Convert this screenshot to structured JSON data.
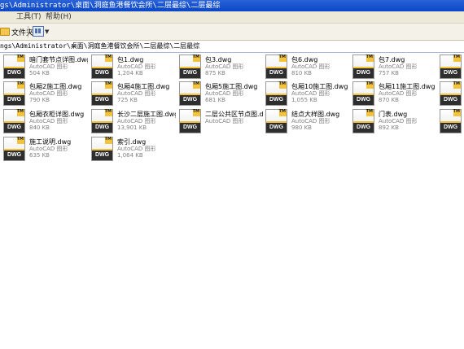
{
  "window": {
    "title": "gs\\Administrator\\桌面\\洞庭鱼港餐饮会所\\二层最综\\二层最综"
  },
  "menubar": {
    "items": [
      "工具(T)",
      "帮助(H)"
    ]
  },
  "toolbar": {
    "folders_label": "文件夹"
  },
  "address": {
    "path": "ngs\\Administrator\\桌面\\洞庭鱼港餐饮会所\\二层最综\\二层最综"
  },
  "file_type": "AutoCAD 图形",
  "icon_label": "DWG",
  "icon_tm": "TM",
  "files": [
    {
      "name": "暗门套节点详图.dwg",
      "size": "504 KB"
    },
    {
      "name": "包1.dwg",
      "size": "1,204 KB"
    },
    {
      "name": "包3.dwg",
      "size": "875 KB"
    },
    {
      "name": "包6.dwg",
      "size": "810 KB"
    },
    {
      "name": "包7.dwg",
      "size": "757 KB"
    },
    {
      "name": "",
      "size": ""
    },
    {
      "name": "包厢2施工图.dwg",
      "size": "790 KB"
    },
    {
      "name": "包厢4施工图.dwg",
      "size": "725 KB"
    },
    {
      "name": "包厢5施工图.dwg",
      "size": "681 KB"
    },
    {
      "name": "包厢10施工图.dwg",
      "size": "1,055 KB"
    },
    {
      "name": "包厢11施工图.dwg",
      "size": "870 KB"
    },
    {
      "name": "",
      "size": ""
    },
    {
      "name": "包厢衣柜详图.dwg",
      "size": "840 KB"
    },
    {
      "name": "长沙二层施工图.dwg",
      "size": "13,901 KB"
    },
    {
      "name": "二层公共区节点图.dwg",
      "size": ""
    },
    {
      "name": "结点大样图.dwg",
      "size": "980 KB"
    },
    {
      "name": "门表.dwg",
      "size": "892 KB"
    },
    {
      "name": "",
      "size": ""
    },
    {
      "name": "施工说明.dwg",
      "size": "635 KB"
    },
    {
      "name": "索引.dwg",
      "size": "1,064 KB"
    }
  ]
}
